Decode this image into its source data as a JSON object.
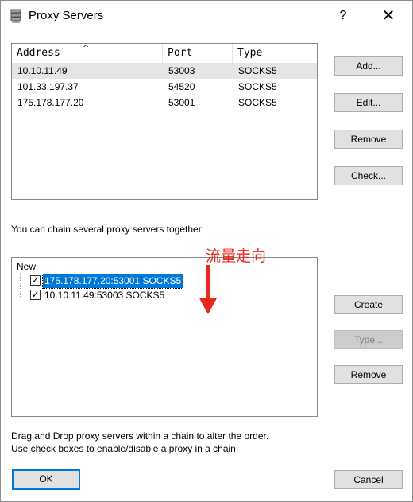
{
  "window": {
    "title": "Proxy Servers",
    "help": "?",
    "close": "✕"
  },
  "proxy_list": {
    "columns": [
      "Address",
      "Port",
      "Type"
    ],
    "sort_indicator": "^",
    "rows": [
      {
        "address": "10.10.11.49",
        "port": "53003",
        "type": "SOCKS5"
      },
      {
        "address": "101.33.197.37",
        "port": "54520",
        "type": "SOCKS5"
      },
      {
        "address": "175.178.177.20",
        "port": "53001",
        "type": "SOCKS5"
      }
    ]
  },
  "buttons": {
    "add": "Add...",
    "edit": "Edit...",
    "remove": "Remove",
    "check": "Check...",
    "create": "Create",
    "type": "Type...",
    "remove2": "Remove",
    "ok": "OK",
    "cancel": "Cancel"
  },
  "chain": {
    "label": "You can chain several proxy servers together:",
    "root": "New",
    "items": [
      {
        "text": "175.178.177.20:53001 SOCKS5",
        "checked": true
      },
      {
        "text": "10.10.11.49:53003 SOCKS5",
        "checked": true
      }
    ]
  },
  "annotation": {
    "text": "流量走向",
    "color": "#e8271d"
  },
  "help_text": {
    "line1": "Drag and Drop proxy servers within a chain to alter the order.",
    "line2": "Use check boxes to enable/disable a proxy in a chain."
  },
  "colors": {
    "selection": "#0078d7",
    "annotation": "#e8271d"
  }
}
